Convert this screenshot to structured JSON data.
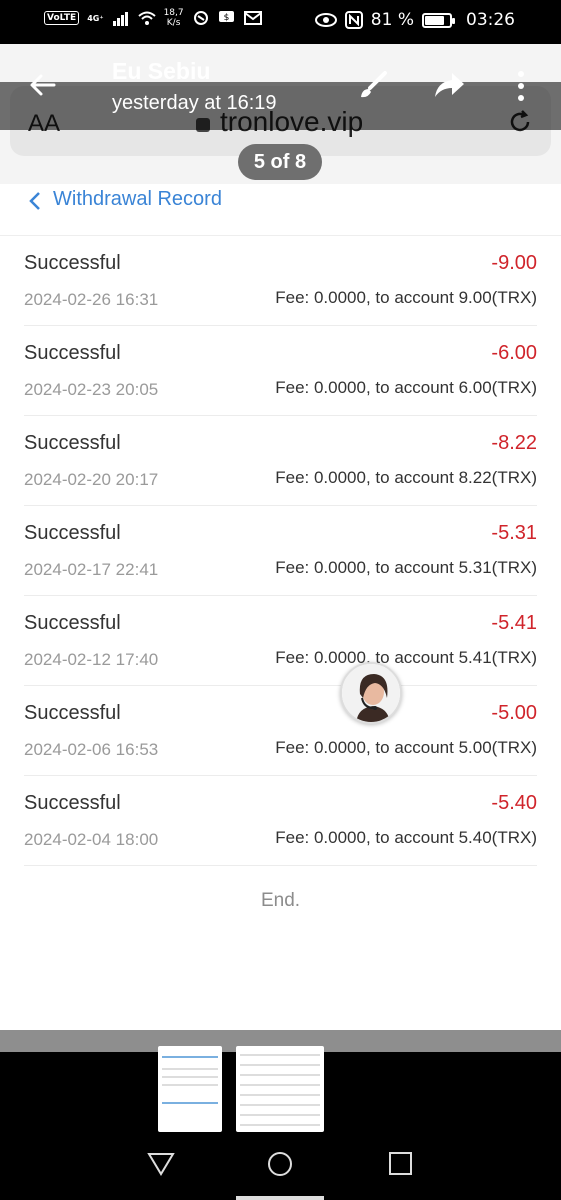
{
  "status_bar": {
    "volte": "VoLTE",
    "network": "4G⁺",
    "speed_value": "18,7",
    "speed_unit": "K/s",
    "battery_percent": "81 %",
    "battery_level": 0.81,
    "time": "03:26"
  },
  "browser": {
    "text_size_label": "AA",
    "url": "tronlove.vip"
  },
  "overlay": {
    "sender_name": "Eu Sebiu",
    "sent_time": "yesterday at 16:19",
    "image_counter": "5 of 8"
  },
  "page": {
    "title": "Withdrawal Record",
    "end_label": "End."
  },
  "records": [
    {
      "status": "Successful",
      "amount": "-9.00",
      "date": "2024-02-26 16:31",
      "detail": "Fee: 0.0000, to account 9.00(TRX)"
    },
    {
      "status": "Successful",
      "amount": "-6.00",
      "date": "2024-02-23 20:05",
      "detail": "Fee: 0.0000, to account 6.00(TRX)"
    },
    {
      "status": "Successful",
      "amount": "-8.22",
      "date": "2024-02-20 20:17",
      "detail": "Fee: 0.0000, to account 8.22(TRX)"
    },
    {
      "status": "Successful",
      "amount": "-5.31",
      "date": "2024-02-17 22:41",
      "detail": "Fee: 0.0000, to account 5.31(TRX)"
    },
    {
      "status": "Successful",
      "amount": "-5.41",
      "date": "2024-02-12 17:40",
      "detail": "Fee: 0.0000, to account 5.41(TRX)"
    },
    {
      "status": "Successful",
      "amount": "-5.00",
      "date": "2024-02-06 16:53",
      "detail": "Fee: 0.0000, to account 5.00(TRX)"
    },
    {
      "status": "Successful",
      "amount": "-5.40",
      "date": "2024-02-04 18:00",
      "detail": "Fee: 0.0000, to account 5.40(TRX)"
    }
  ],
  "colors": {
    "accent": "#3a84d6",
    "negative_amount": "#d0242b"
  },
  "icons": {
    "back": "back-arrow-icon",
    "edit": "brush-icon",
    "share": "share-icon",
    "more": "more-vertical-icon",
    "reload": "reload-icon",
    "support": "support-agent-icon"
  }
}
